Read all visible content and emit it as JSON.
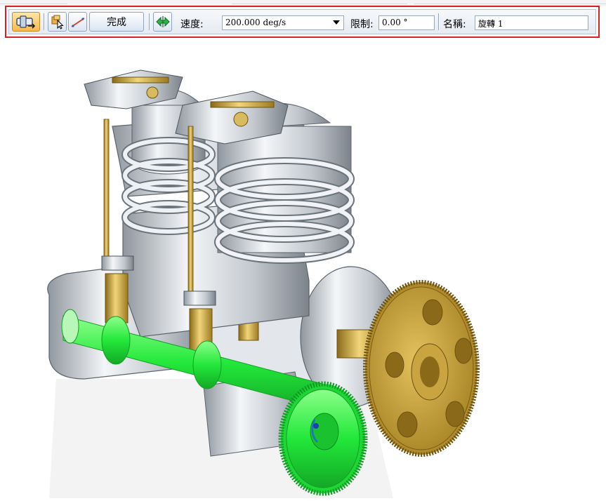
{
  "toolbar": {
    "done_label": "完成",
    "speed_label": "速度:",
    "speed_value": "200.000 deg/s",
    "limit_label": "限制:",
    "limit_value": "0.00 °",
    "name_label": "名稱:",
    "name_value": "旋轉 1"
  },
  "icons": {
    "motor": "rotary-motor-icon",
    "select": "select-component-icon",
    "axis": "axis-line-icon",
    "flip": "flip-direction-icon"
  },
  "colors": {
    "highlight_frame": "#d62128",
    "active_button": "#f7b94a",
    "selected_part": "#22e83a",
    "brass": "#c9a440",
    "steel": "#cfd3d9"
  }
}
